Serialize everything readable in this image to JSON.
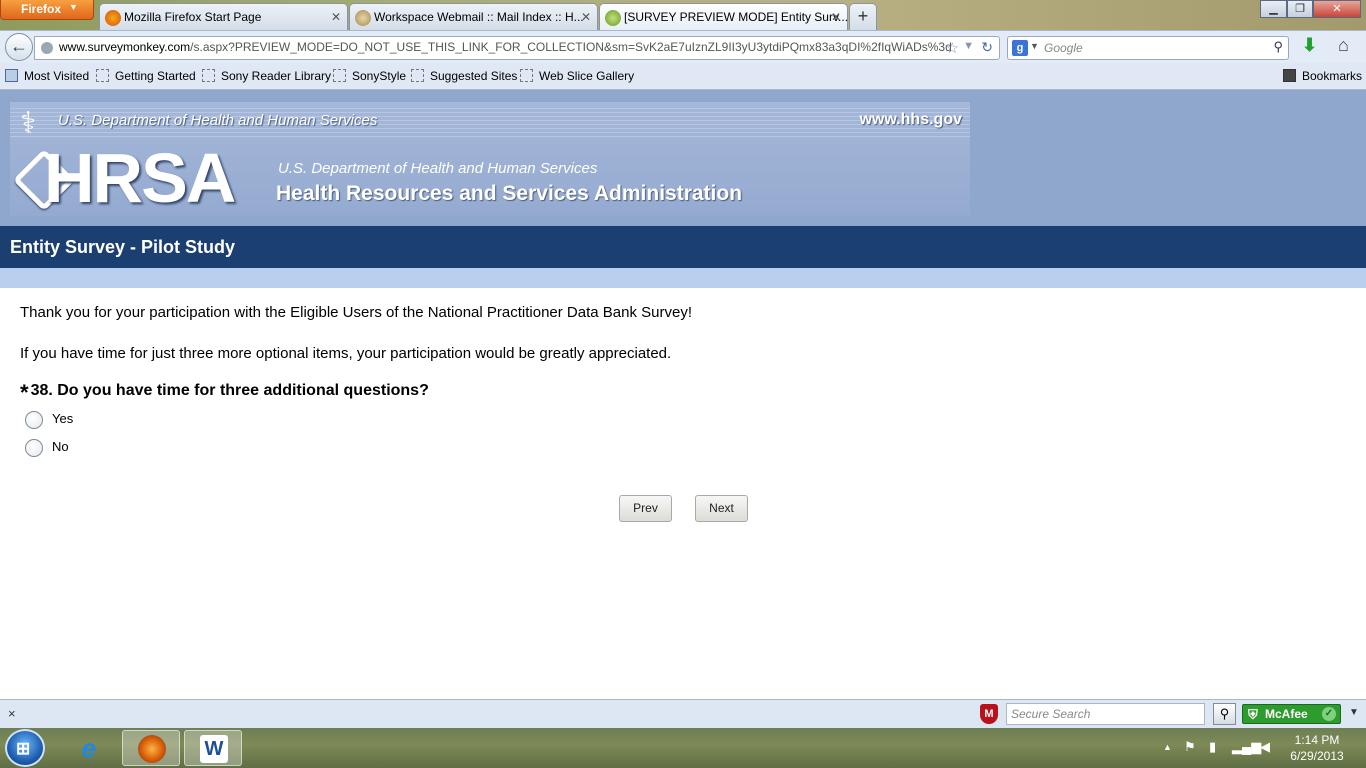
{
  "browser": {
    "menu_label": "Firefox",
    "tabs": [
      {
        "title": "Mozilla Firefox Start Page"
      },
      {
        "title": "Workspace Webmail :: Mail Index :: H..."
      },
      {
        "title": "[SURVEY PREVIEW MODE] Entity Surv..."
      }
    ],
    "new_tab_label": "+",
    "url_domain": "www.surveymonkey.com",
    "url_path": "/s.aspx?PREVIEW_MODE=DO_NOT_USE_THIS_LINK_FOR_COLLECTION&sm=SvK2aE7uIznZL9II3yU3ytdiPQmx83a3qDI%2fIqWiADs%3d",
    "search_placeholder": "Google",
    "bookmarks": [
      "Most Visited",
      "Getting Started",
      "Sony Reader Library",
      "SonyStyle",
      "Suggested Sites",
      "Web Slice Gallery"
    ],
    "bookmarks_menu": "Bookmarks"
  },
  "banner": {
    "dept_top": "U.S. Department of Health and Human Services",
    "website": "www.hhs.gov",
    "logo": "HRSA",
    "dept_sub": "U.S. Department of Health and Human Services",
    "agency": "Health Resources and Services Administration"
  },
  "survey": {
    "title": "Entity Survey - Pilot Study",
    "thanks": "Thank you for your participation with the Eligible Users of the National Practitioner Data Bank Survey!",
    "optional_note": "If you have time for just three more optional items, your participation would be greatly appreciated.",
    "required_mark": "*",
    "question": "38. Do you have time for three additional questions?",
    "options": [
      "Yes",
      "No"
    ],
    "prev_label": "Prev",
    "next_label": "Next"
  },
  "addon_bar": {
    "close": "×",
    "secure_search_placeholder": "Secure Search",
    "mcafee_label": "McAfee"
  },
  "taskbar": {
    "time": "1:14 PM",
    "date": "6/29/2013"
  },
  "colors": {
    "title_bar": "#1c3f72",
    "header_bg": "#90a7cd",
    "light_strip": "#b8cfee",
    "firefox_button": "#e0661a"
  }
}
